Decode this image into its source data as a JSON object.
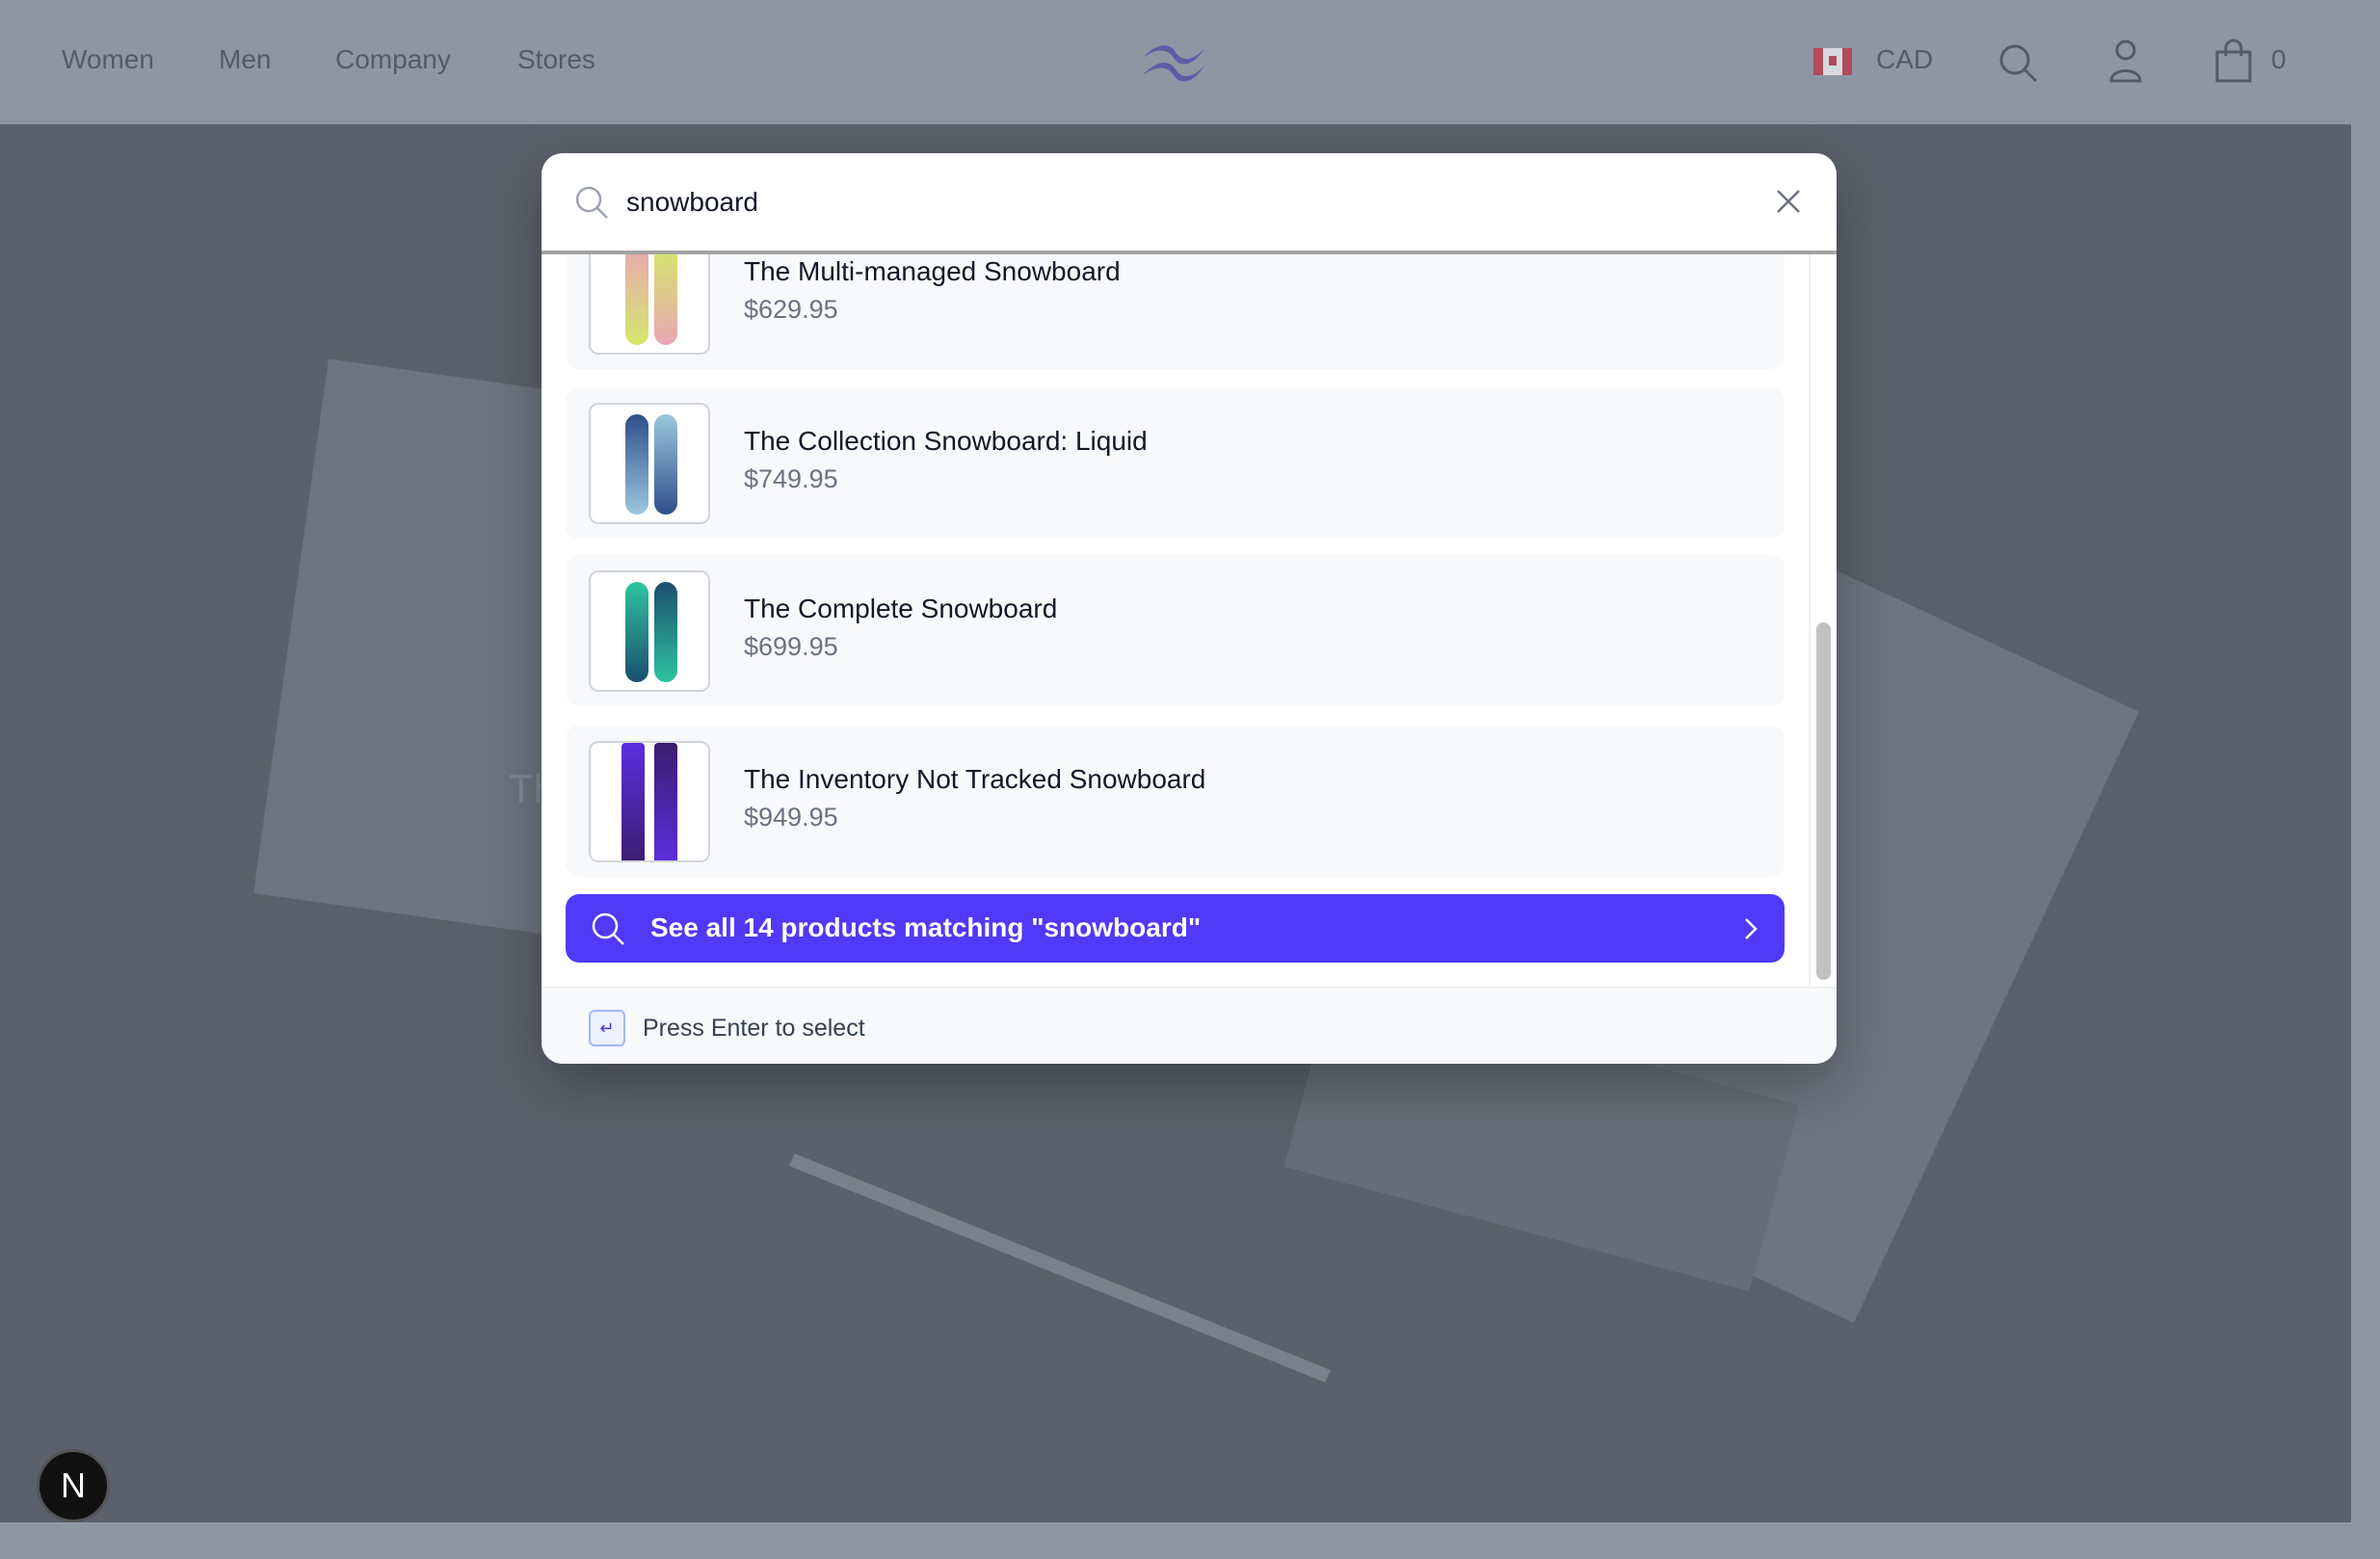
{
  "header": {
    "nav": [
      {
        "label": "Women"
      },
      {
        "label": "Men"
      },
      {
        "label": "Company"
      },
      {
        "label": "Stores"
      }
    ],
    "currency": "CAD",
    "cart_count": "0",
    "logo_icon": "tailwind-wave-logo",
    "logo_color": "#5b5ea6"
  },
  "hero": {
    "partial_text": "Th"
  },
  "search": {
    "value": "snowboard",
    "results": [
      {
        "title": "The Multi-managed Snowboard",
        "price": "$629.95",
        "colors": [
          "#e9a6b4",
          "#d4e86a"
        ]
      },
      {
        "title": "The Collection Snowboard: Liquid",
        "price": "$749.95",
        "colors": [
          "#2f4f8a",
          "#9cc7de"
        ]
      },
      {
        "title": "The Complete Snowboard",
        "price": "$699.95",
        "colors": [
          "#2ec4a0",
          "#1c4e6e"
        ]
      },
      {
        "title": "The Inventory Not Tracked Snowboard",
        "price": "$949.95",
        "colors": [
          "#5b2fe0",
          "#3a1d6e"
        ]
      }
    ],
    "see_all_label": "See all 14 products matching \"snowboard\"",
    "footer_hint": "Press Enter to select",
    "enter_key_glyph": "↵",
    "accent": "#5039f7"
  },
  "dev_badge": {
    "label": "N"
  }
}
